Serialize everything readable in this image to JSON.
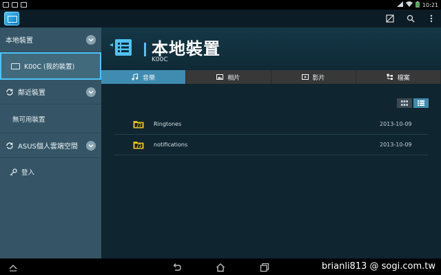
{
  "status_bar": {
    "time": "10:21"
  },
  "action_bar": {
    "icons": [
      "app-icon",
      "screenshot-icon",
      "search-icon",
      "overflow-menu-icon"
    ]
  },
  "sidebar": {
    "sections": [
      {
        "label": "本地裝置"
      },
      {
        "label": "鄰近裝置"
      },
      {
        "label": "ASUS個人雲端空間"
      }
    ],
    "device_item": "K00C (我的裝置)",
    "no_devices": "無可用裝置",
    "login": "登入"
  },
  "header": {
    "title": "本地裝置",
    "subtitle": "K00C"
  },
  "tabs": [
    {
      "label": "音樂",
      "icon": "music-note-icon"
    },
    {
      "label": "相片",
      "icon": "photo-icon"
    },
    {
      "label": "影片",
      "icon": "video-icon"
    },
    {
      "label": "檔案",
      "icon": "file-tree-icon"
    }
  ],
  "view_modes": {
    "active": "list"
  },
  "files": [
    {
      "name": "Ringtones",
      "date": "2013-10-09"
    },
    {
      "name": "notifications",
      "date": "2013-10-09"
    }
  ],
  "watermark": "brianli813 @ sogi.com.tw",
  "colors": {
    "accent": "#3f8cb0",
    "highlight": "#4fc3f7",
    "folder": "#e8c21a"
  }
}
